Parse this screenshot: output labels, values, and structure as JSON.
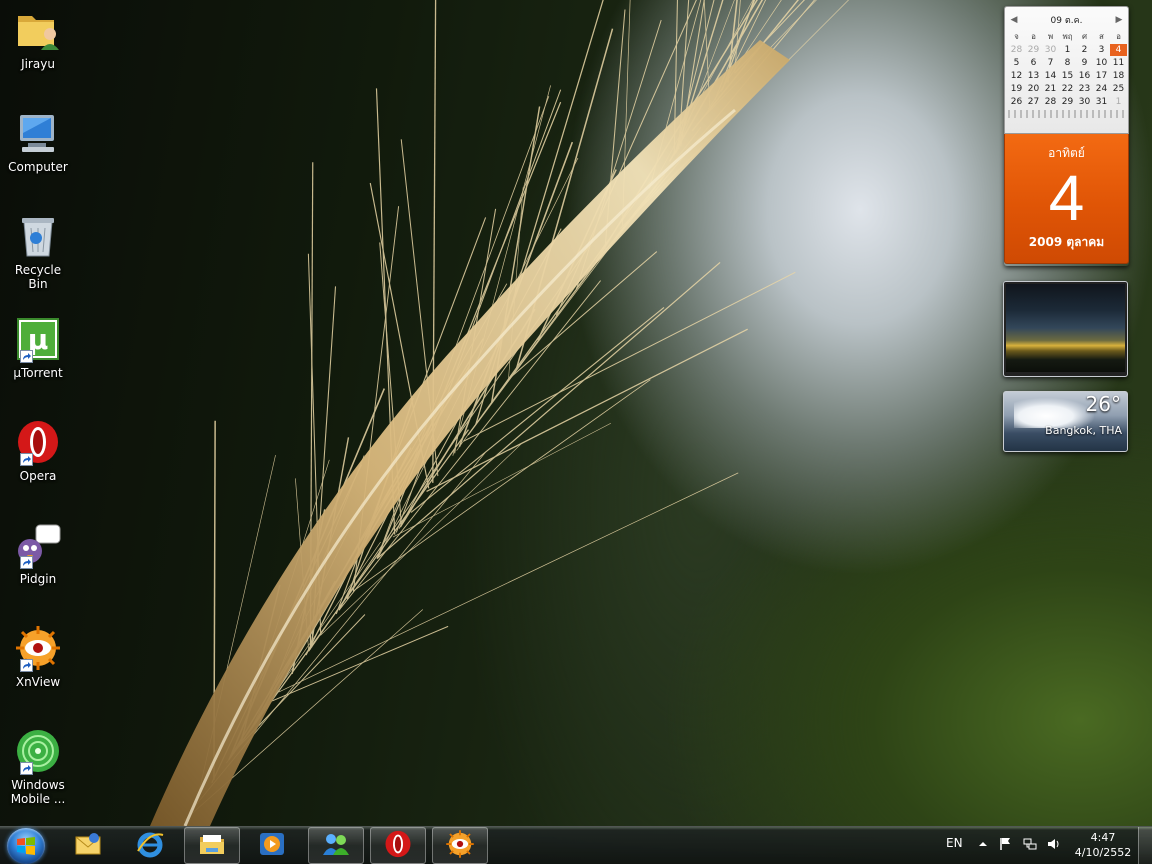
{
  "desktop": {
    "icons": [
      {
        "label": "Jirayu",
        "icon": "user-folder-icon"
      },
      {
        "label": "Computer",
        "icon": "computer-icon"
      },
      {
        "label": "Recycle Bin",
        "icon": "recycle-bin-icon"
      },
      {
        "label": "µTorrent",
        "icon": "utorrent-icon"
      },
      {
        "label": "Opera",
        "icon": "opera-icon"
      },
      {
        "label": "Pidgin",
        "icon": "pidgin-icon"
      },
      {
        "label": "XnView",
        "icon": "xnview-icon"
      },
      {
        "label": "Windows Mobile ...",
        "icon": "windows-mobile-icon"
      }
    ]
  },
  "gadgets": {
    "calendar": {
      "month_header": "09 ต.ค.",
      "weekdays": [
        "จ",
        "อ",
        "พ",
        "พฤ",
        "ศ",
        "ส",
        "อ"
      ],
      "weeks": [
        [
          "28",
          "29",
          "30",
          "1",
          "2",
          "3",
          "4"
        ],
        [
          "5",
          "6",
          "7",
          "8",
          "9",
          "10",
          "11"
        ],
        [
          "12",
          "13",
          "14",
          "15",
          "16",
          "17",
          "18"
        ],
        [
          "19",
          "20",
          "21",
          "22",
          "23",
          "24",
          "25"
        ],
        [
          "26",
          "27",
          "28",
          "29",
          "30",
          "31",
          "1"
        ]
      ],
      "day_name": "อาทิตย์",
      "day_number": "4",
      "year_month": "2009 ตุลาคม",
      "accent": "#e8621e"
    },
    "weather": {
      "temperature": "26°",
      "city": "Bangkok, THA"
    }
  },
  "taskbar": {
    "pinned": [
      {
        "name": "outlook-express-icon",
        "open": false
      },
      {
        "name": "internet-explorer-icon",
        "open": false
      },
      {
        "name": "windows-explorer-icon",
        "open": true
      },
      {
        "name": "media-player-icon",
        "open": false
      },
      {
        "name": "messenger-icon",
        "open": true
      },
      {
        "name": "opera-icon",
        "open": true
      },
      {
        "name": "xnview-icon",
        "open": true
      }
    ],
    "language": "EN",
    "time": "4:47",
    "date": "4/10/2552"
  }
}
